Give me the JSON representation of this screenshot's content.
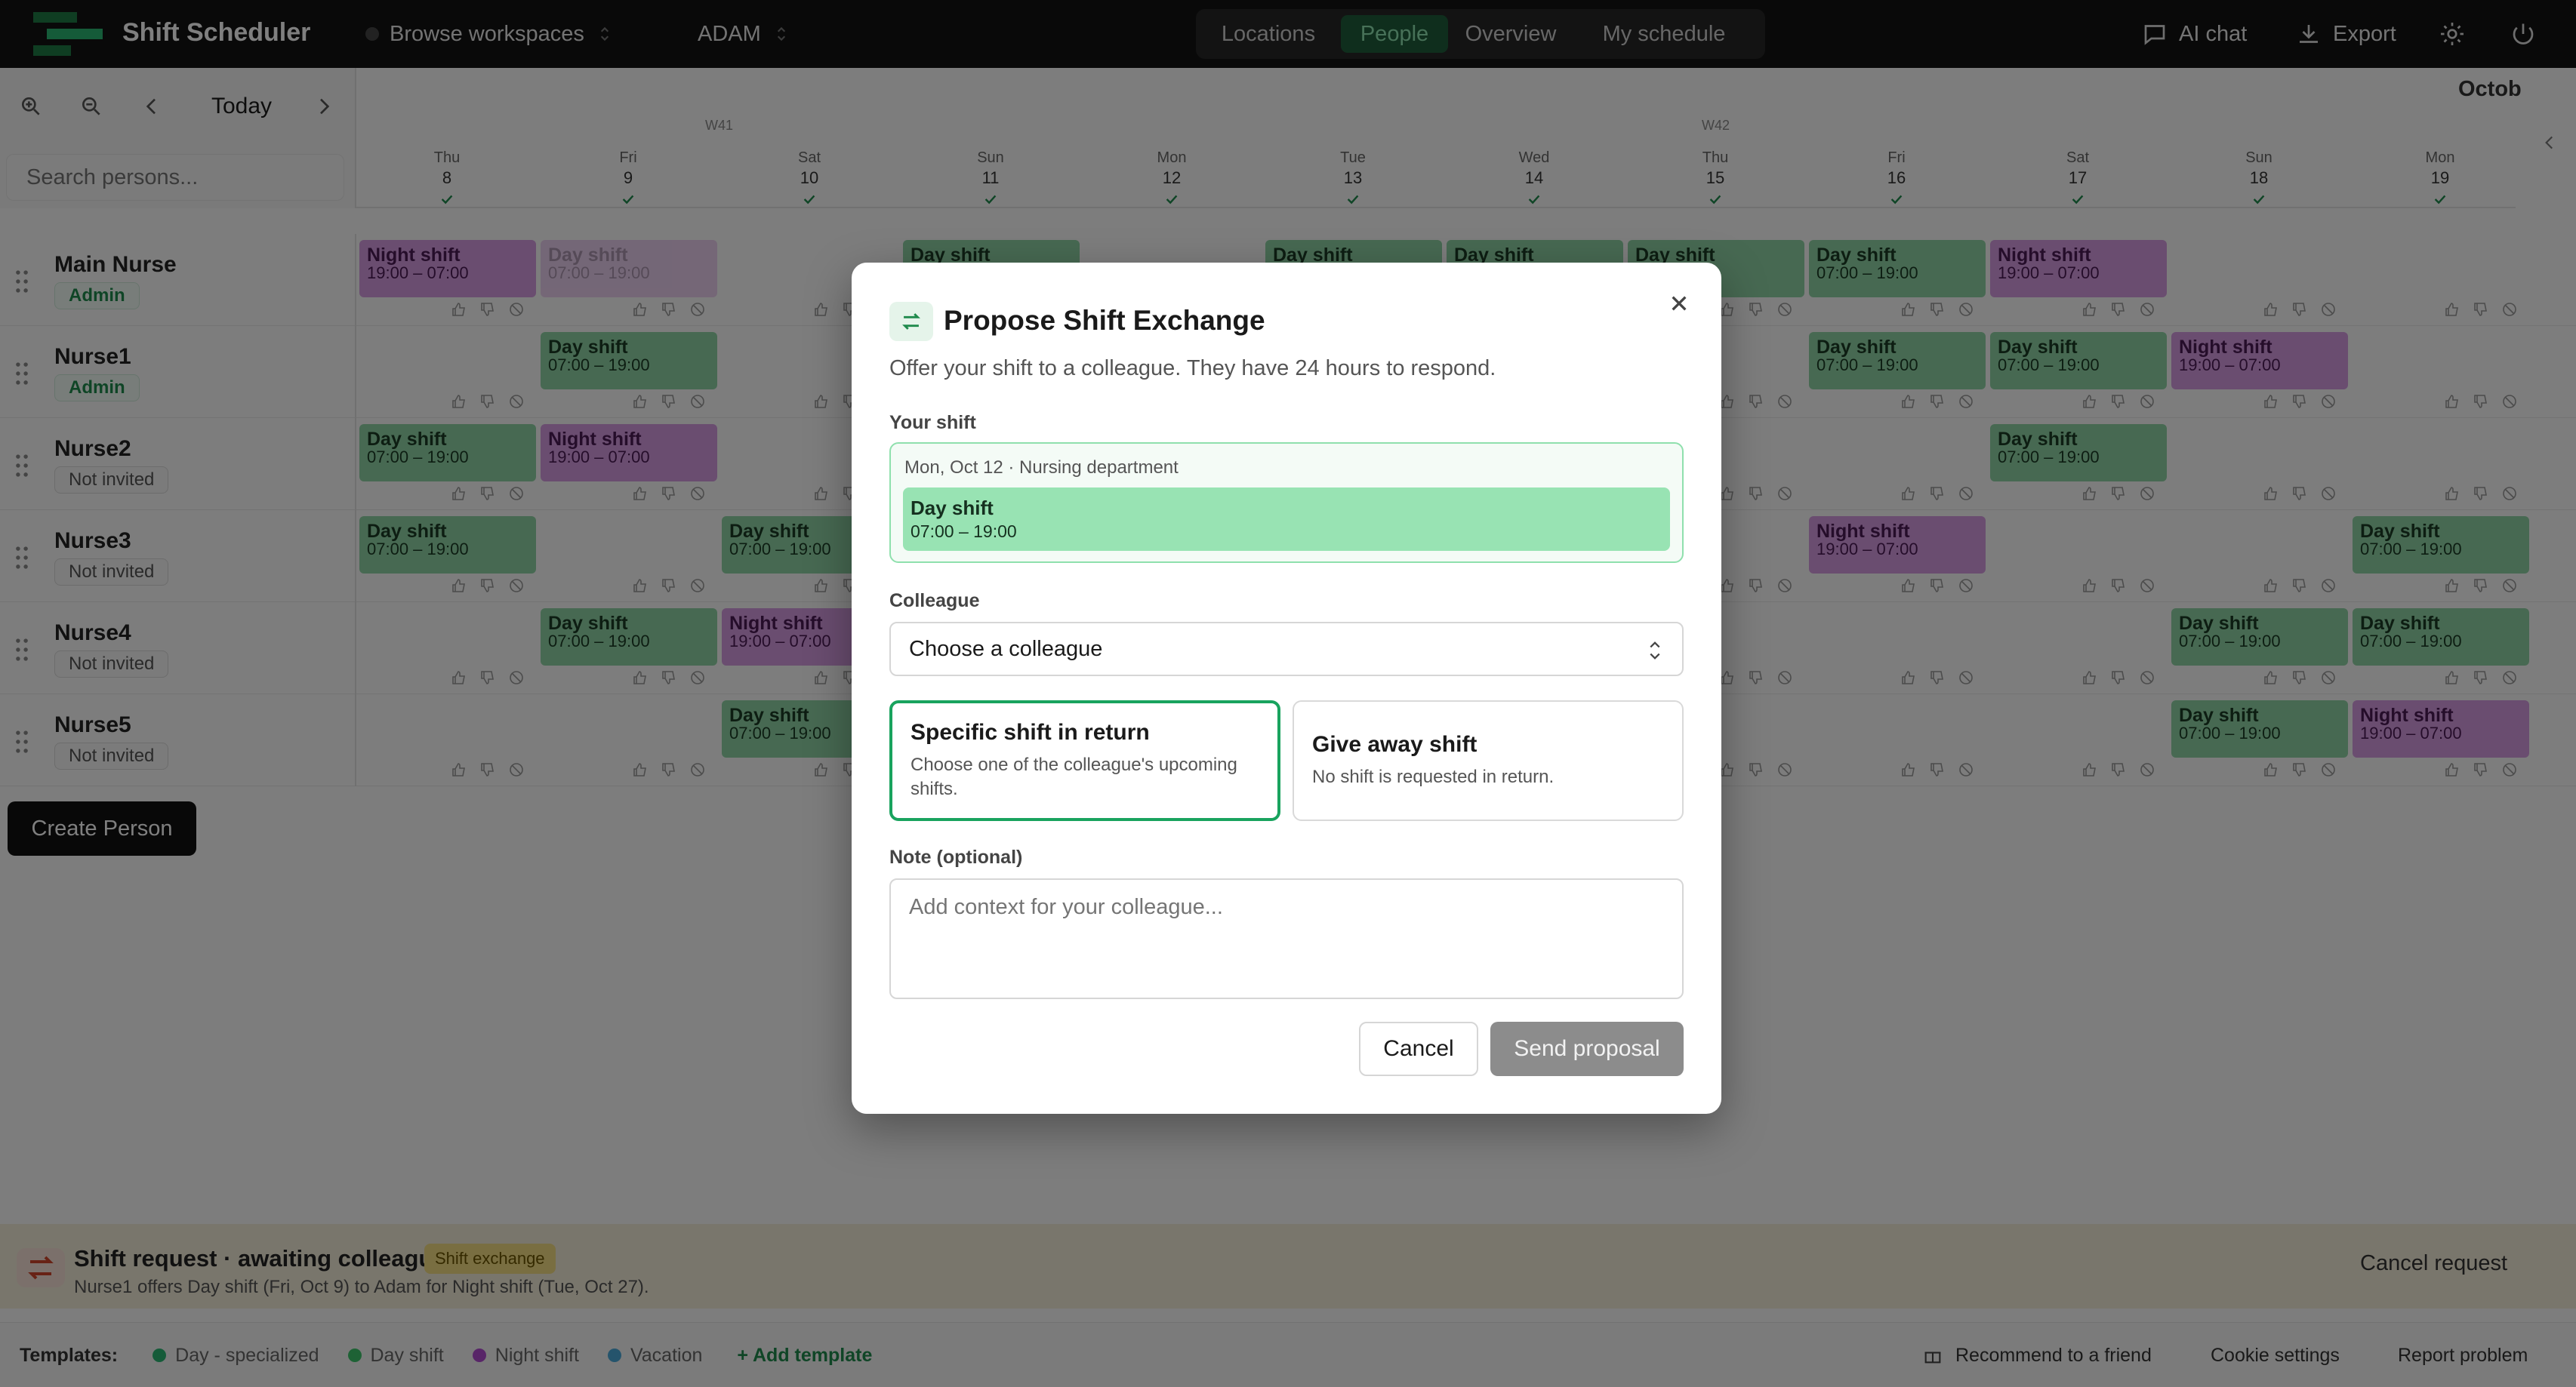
{
  "app": {
    "title": "Shift Scheduler",
    "workspace": "Browse workspaces",
    "user": "ADAM"
  },
  "nav": {
    "tabs": [
      {
        "label": "Locations",
        "active": false
      },
      {
        "label": "People",
        "active": true
      },
      {
        "label": "Overview",
        "active": false
      },
      {
        "label": "My schedule",
        "active": false
      }
    ]
  },
  "topright": {
    "ai_chat": "AI chat",
    "export": "Export",
    "icons": [
      "settings-icon",
      "power-icon"
    ]
  },
  "calendar": {
    "today_label": "Today",
    "search_placeholder": "Search persons...",
    "month_label": "Octob",
    "weeks": [
      "W41",
      "W42"
    ],
    "days": [
      {
        "name": "Thu",
        "date": "8"
      },
      {
        "name": "Fri",
        "date": "9"
      },
      {
        "name": "Sat",
        "date": "10"
      },
      {
        "name": "Sun",
        "date": "11"
      },
      {
        "name": "Mon",
        "date": "12"
      },
      {
        "name": "Tue",
        "date": "13"
      },
      {
        "name": "Wed",
        "date": "14"
      },
      {
        "name": "Thu",
        "date": "15"
      },
      {
        "name": "Fri",
        "date": "16"
      },
      {
        "name": "Sat",
        "date": "17"
      },
      {
        "name": "Sun",
        "date": "18"
      },
      {
        "name": "Mon",
        "date": "19"
      }
    ],
    "persons": [
      {
        "name": "Main Nurse",
        "role": "Admin"
      },
      {
        "name": "Nurse1",
        "role": "Admin"
      },
      {
        "name": "Nurse2",
        "role": "Not invited"
      },
      {
        "name": "Nurse3",
        "role": "Not invited"
      },
      {
        "name": "Nurse4",
        "role": "Not invited"
      },
      {
        "name": "Nurse5",
        "role": "Not invited"
      }
    ],
    "shifts": [
      {
        "row": 0,
        "day": 0,
        "type": "night",
        "name": "Night shift",
        "time": "19:00 – 07:00"
      },
      {
        "row": 0,
        "day": 1,
        "type": "night",
        "name": "Day shift",
        "time": "07:00 – 19:00",
        "faded": true
      },
      {
        "row": 0,
        "day": 3,
        "type": "day",
        "name": "Day shift",
        "time": ""
      },
      {
        "row": 0,
        "day": 5,
        "type": "day",
        "name": "Day shift",
        "time": ""
      },
      {
        "row": 0,
        "day": 6,
        "type": "day",
        "name": "Day shift",
        "time": ""
      },
      {
        "row": 0,
        "day": 7,
        "type": "day",
        "name": "Day shift",
        "time": ""
      },
      {
        "row": 0,
        "day": 8,
        "type": "day",
        "name": "Day shift",
        "time": "07:00 – 19:00"
      },
      {
        "row": 0,
        "day": 9,
        "type": "night",
        "name": "Night shift",
        "time": "19:00 – 07:00"
      },
      {
        "row": 1,
        "day": 1,
        "type": "day",
        "name": "Day shift",
        "time": "07:00 – 19:00"
      },
      {
        "row": 1,
        "day": 8,
        "type": "day",
        "name": "Day shift",
        "time": "07:00 – 19:00"
      },
      {
        "row": 1,
        "day": 9,
        "type": "day",
        "name": "Day shift",
        "time": "07:00 – 19:00"
      },
      {
        "row": 1,
        "day": 10,
        "type": "night",
        "name": "Night shift",
        "time": "19:00 – 07:00"
      },
      {
        "row": 2,
        "day": 0,
        "type": "day",
        "name": "Day shift",
        "time": "07:00 – 19:00"
      },
      {
        "row": 2,
        "day": 1,
        "type": "night",
        "name": "Night shift",
        "time": "19:00 – 07:00"
      },
      {
        "row": 2,
        "day": 9,
        "type": "day",
        "name": "Day shift",
        "time": "07:00 – 19:00"
      },
      {
        "row": 3,
        "day": 0,
        "type": "day",
        "name": "Day shift",
        "time": "07:00 – 19:00"
      },
      {
        "row": 3,
        "day": 2,
        "type": "day",
        "name": "Day shift",
        "time": "07:00 – 19:00"
      },
      {
        "row": 3,
        "day": 8,
        "type": "night",
        "name": "Night shift",
        "time": "19:00 – 07:00"
      },
      {
        "row": 3,
        "day": 11,
        "type": "day",
        "name": "Day shift",
        "time": "07:00 – 19:00"
      },
      {
        "row": 4,
        "day": 1,
        "type": "day",
        "name": "Day shift",
        "time": "07:00 – 19:00"
      },
      {
        "row": 4,
        "day": 2,
        "type": "night",
        "name": "Night shift",
        "time": "19:00 – 07:00"
      },
      {
        "row": 4,
        "day": 10,
        "type": "day",
        "name": "Day shift",
        "time": "07:00 – 19:00"
      },
      {
        "row": 4,
        "day": 11,
        "type": "day",
        "name": "Day shift",
        "time": "07:00 – 19:00"
      },
      {
        "row": 5,
        "day": 2,
        "type": "day",
        "name": "Day shift",
        "time": "07:00 – 19:00"
      },
      {
        "row": 5,
        "day": 10,
        "type": "day",
        "name": "Day shift",
        "time": "07:00 – 19:00"
      },
      {
        "row": 5,
        "day": 11,
        "type": "night",
        "name": "Night shift",
        "time": "19:00 – 07:00"
      }
    ],
    "create_person": "Create Person"
  },
  "request_banner": {
    "title": "Shift request · awaiting colleague",
    "badge": "Shift exchange",
    "description": "Nurse1 offers Day shift (Fri, Oct 9) to Adam for Night shift (Tue, Oct 27).",
    "cancel_label": "Cancel request"
  },
  "footer": {
    "templates_label": "Templates:",
    "templates": [
      {
        "name": "Day - specialized",
        "color": "#2bb673"
      },
      {
        "name": "Day shift",
        "color": "#3cc46a"
      },
      {
        "name": "Night shift",
        "color": "#b04ad0"
      },
      {
        "name": "Vacation",
        "color": "#4aa8d8"
      }
    ],
    "add_template": "+ Add template",
    "recommend": "Recommend to a friend",
    "cookie": "Cookie settings",
    "report": "Report problem"
  },
  "modal": {
    "title": "Propose Shift Exchange",
    "subtitle": "Offer your shift to a colleague. They have 24 hours to respond.",
    "your_shift_label": "Your shift",
    "shift_meta": "Mon, Oct 12 · Nursing department",
    "shift_name": "Day shift",
    "shift_time": "07:00 – 19:00",
    "colleague_label": "Colleague",
    "colleague_value": "Choose a colleague",
    "options": [
      {
        "title": "Specific shift in return",
        "desc": "Choose one of the colleague's upcoming shifts.",
        "selected": true
      },
      {
        "title": "Give away shift",
        "desc": "No shift is requested in return.",
        "selected": false
      }
    ],
    "note_label": "Note (optional)",
    "note_placeholder": "Add context for your colleague...",
    "cancel": "Cancel",
    "send": "Send proposal"
  },
  "colors": {
    "accent": "#19a35e",
    "day_shift": "#8fd3a4",
    "night_shift": "#d49ae0",
    "topbar": "#121212"
  }
}
